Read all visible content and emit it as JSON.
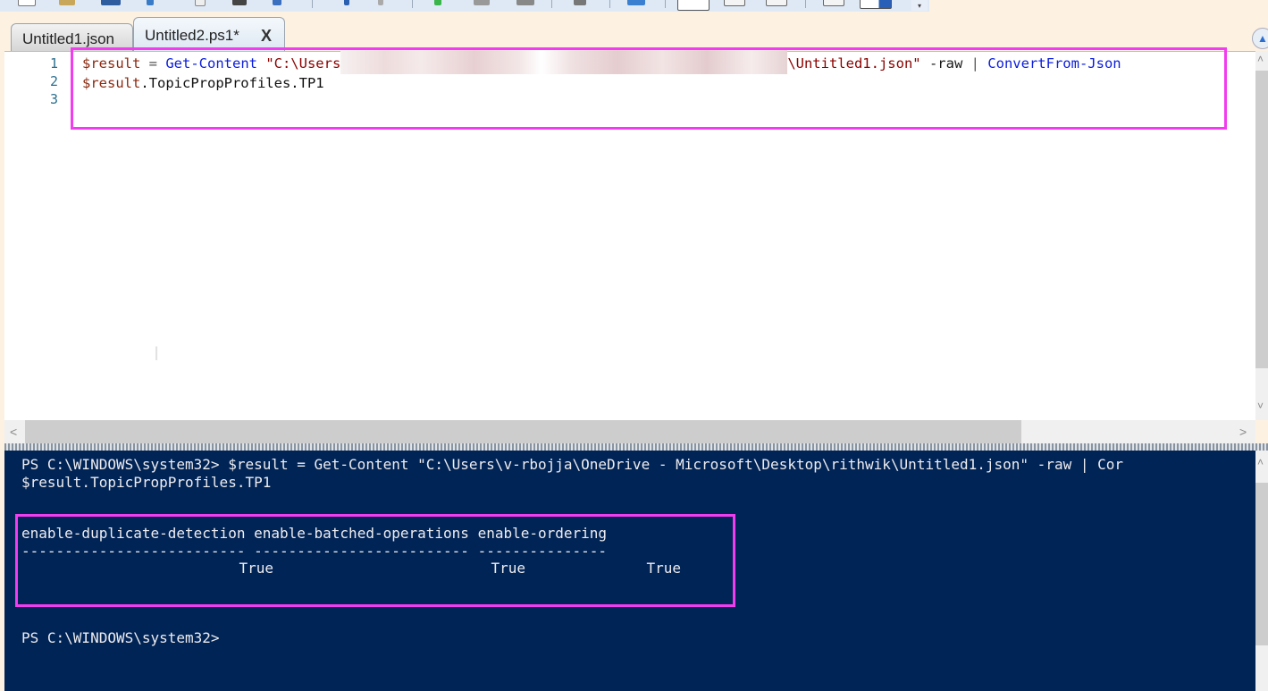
{
  "toolbar": {
    "icons": [
      "new-file",
      "open-file",
      "save",
      "cut",
      "copy",
      "paste",
      "clear",
      "undo",
      "redo",
      "run",
      "run-selection",
      "stop",
      "remote",
      "powershell",
      "layout-script-top",
      "layout-script-right",
      "layout-script-max",
      "show-script",
      "show-console"
    ],
    "overflow_label": "▾"
  },
  "tabs": [
    {
      "label": "Untitled1.json",
      "active": false
    },
    {
      "label": "Untitled2.ps1*",
      "active": true,
      "close_label": "X"
    }
  ],
  "editor": {
    "line_numbers": [
      "1",
      "2",
      "3"
    ],
    "lines": [
      {
        "var": "$result",
        "op": " = ",
        "cmd": "Get-Content",
        "str_start": " \"C:\\Users",
        "redacted": true,
        "str_end": "\\Untitled1.json\"",
        "param": " -raw",
        "pipe": " | ",
        "cmd2": "ConvertFrom-Json"
      },
      {
        "var": "$result",
        "member": ".TopicPropProfiles.TP1"
      },
      {}
    ]
  },
  "console": {
    "command_line": "PS C:\\WINDOWS\\system32> $result = Get-Content \"C:\\Users\\v-rbojja\\OneDrive - Microsoft\\Desktop\\rithwik\\Untitled1.json\" -raw | Cor",
    "continuation_line": "$result.TopicPropProfiles.TP1",
    "table": {
      "headers": [
        "enable-duplicate-detection",
        "enable-batched-operations",
        "enable-ordering"
      ],
      "separators": [
        "--------------------------",
        "-------------------------",
        "---------------"
      ],
      "values": [
        "True",
        "True",
        "True"
      ]
    },
    "prompt": "PS C:\\WINDOWS\\system32>"
  },
  "colors": {
    "highlight": "#f23cef",
    "console_bg": "#012456",
    "console_fg": "#eeedf0",
    "cmdlet": "#0a1cde",
    "variable": "#8b2a10",
    "string": "#8b0000"
  }
}
